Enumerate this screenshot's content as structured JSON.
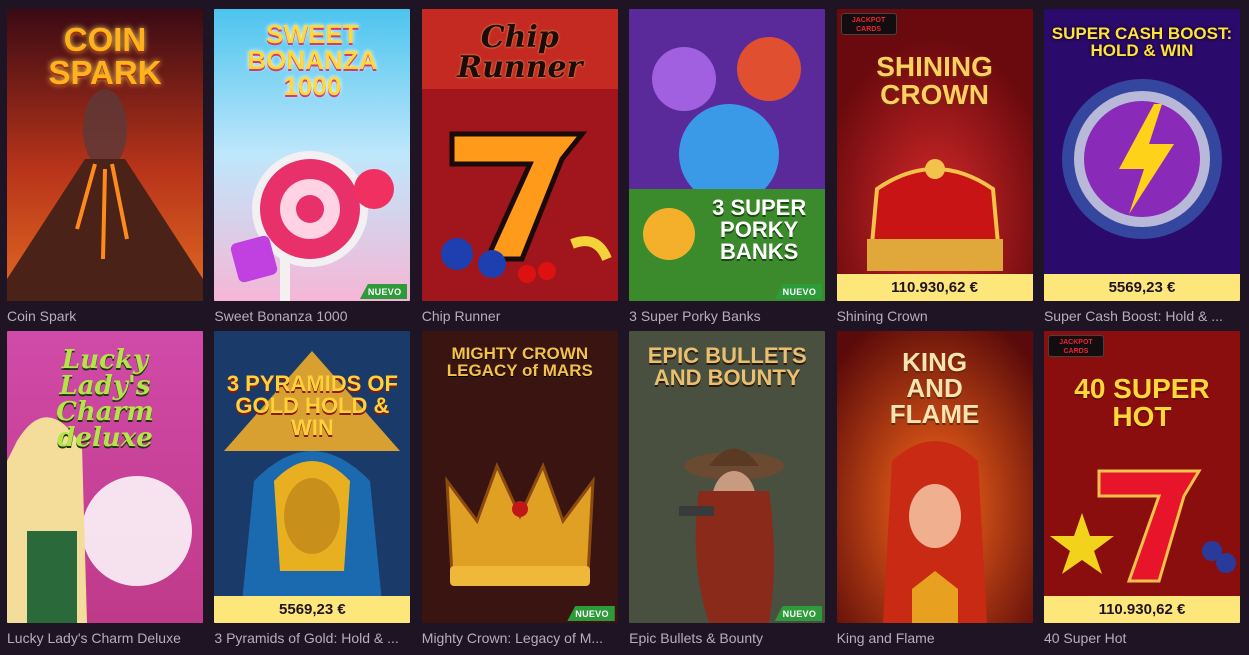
{
  "games": [
    {
      "title": "Coin Spark",
      "logo_text": "COIN SPARK"
    },
    {
      "title": "Sweet Bonanza 1000",
      "logo_text": "SWEET BONANZA 1000",
      "badge": "NUEVO"
    },
    {
      "title": "Chip Runner",
      "logo_text": "Chip Runner"
    },
    {
      "title": "3 Super Porky Banks",
      "logo_text": "3 SUPER PORKY BANKS",
      "badge": "NUEVO"
    },
    {
      "title": "Shining Crown",
      "logo_text": "SHINING CROWN",
      "jackpot": "110.930,62 €"
    },
    {
      "title": "Super Cash Boost: Hold & ...",
      "logo_text": "SUPER CASH BOOST: HOLD & WIN",
      "jackpot": "5569,23 €"
    },
    {
      "title": "Lucky Lady's Charm Deluxe",
      "logo_text": "Lucky Lady's Charm deluxe"
    },
    {
      "title": "3 Pyramids of Gold: Hold & ...",
      "logo_text": "3 PYRAMIDS OF GOLD HOLD & WIN",
      "jackpot": "5569,23 €"
    },
    {
      "title": "Mighty Crown: Legacy of M...",
      "logo_text": "MIGHTY CROWN LEGACY of MARS",
      "badge": "NUEVO"
    },
    {
      "title": "Epic Bullets & Bounty",
      "logo_text": "EPIC BULLETS AND BOUNTY",
      "badge": "NUEVO"
    },
    {
      "title": "King and Flame",
      "logo_text": "KING AND FLAME"
    },
    {
      "title": "40 Super Hot",
      "logo_text": "40 SUPER HOT",
      "jackpot": "110.930,62 €"
    }
  ],
  "jackpot_logo": {
    "line1": "JACKPOT",
    "line2": "CARDS"
  }
}
